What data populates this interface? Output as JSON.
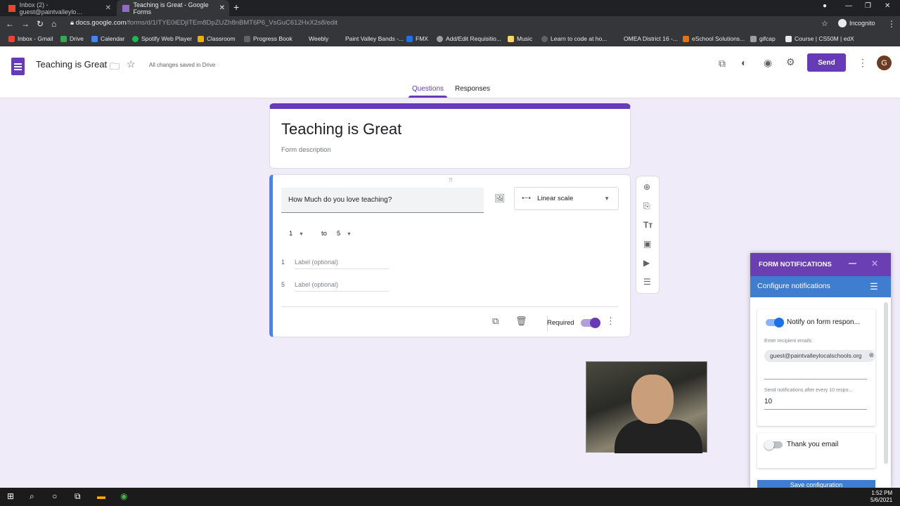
{
  "browser": {
    "tabs": [
      {
        "label": "Inbox (2) - guest@paintvalleylo…",
        "active": false
      },
      {
        "label": "Teaching is Great - Google Forms",
        "active": true
      }
    ],
    "url_host": "docs.google.com",
    "url_path": "/forms/d/1ITYE0iEDjITEm8DpZUZh8nBMT6P6_VsGuC612HxX2s8/edit",
    "incognito": "Incognito",
    "bookmarks": [
      "Inbox - Gmail",
      "Drive",
      "Calendar",
      "Spotify Web Player",
      "Classroom",
      "Progress Book",
      "Weebly",
      "Paint Valley Bands -...",
      "FMX",
      "Add/Edit Requisitio...",
      "Music",
      "Learn to code at ho...",
      "OMEA District 16 -...",
      "eSchool Solutions...",
      "gifcap",
      "Course | CS50M | edX"
    ]
  },
  "header": {
    "doc_title": "Teaching is Great",
    "saved_status": "All changes saved in Drive",
    "send_label": "Send",
    "account_initial": "G"
  },
  "tabs": {
    "questions": "Questions",
    "responses": "Responses"
  },
  "form": {
    "title": "Teaching is Great",
    "description_placeholder": "Form description"
  },
  "question": {
    "text": "How Much do you love teaching?",
    "type": "Linear scale",
    "scale_min": "1",
    "scale_to": "to",
    "scale_max": "5",
    "labels": [
      {
        "num": "1",
        "placeholder": "Label (optional)"
      },
      {
        "num": "5",
        "placeholder": "Label (optional)"
      }
    ],
    "required_label": "Required",
    "required_on": true
  },
  "notifications": {
    "header": "FORM NOTIFICATIONS",
    "subheader": "Configure notifications",
    "notify_label": "Notify on form respon...",
    "notify_on": true,
    "recipients_label": "Enter recipient emails",
    "recipient_email": "guest@paintvalleylocalschools.org",
    "every_label": "Send notifications after every 10 respo...",
    "every_value": "10",
    "thanks_label": "Thank you email",
    "thanks_on": false,
    "save_label": "Save configuration"
  },
  "taskbar": {
    "time": "1:52 PM",
    "date": "5/6/2021"
  },
  "colors": {
    "accent": "#673ab7",
    "background": "#f0ebf8",
    "panel_blue": "#3f7dd1"
  }
}
